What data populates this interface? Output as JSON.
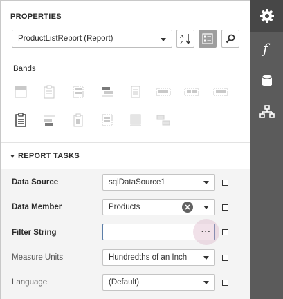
{
  "properties": {
    "title": "PROPERTIES",
    "selected_component": "ProductListReport (Report)"
  },
  "toolbar": {
    "sort_icon": "sort-alphabetical-icon",
    "categorized_icon": "categorized-view-icon",
    "search_icon": "search-icon"
  },
  "bands": {
    "label": "Bands"
  },
  "report_tasks": {
    "header": "REPORT TASKS",
    "rows": [
      {
        "label": "Data Source",
        "value": "sqlDataSource1",
        "placeholder": ""
      },
      {
        "label": "Data Member",
        "value": "Products",
        "placeholder": ""
      },
      {
        "label": "Filter String",
        "value": "",
        "placeholder": ""
      },
      {
        "label": "Measure Units",
        "value": "Hundredths of an Inch",
        "placeholder": ""
      },
      {
        "label": "Language",
        "value": "(Default)",
        "placeholder": ""
      }
    ],
    "ellipsis": "···"
  },
  "side_tabs": [
    "gear-icon",
    "function-icon",
    "database-icon",
    "hierarchy-icon"
  ],
  "colors": {
    "rail": "#5b5b5b",
    "rail_active": "#474747",
    "tasks_background": "#f4f4f4",
    "focus_border": "#5c7ea8",
    "ellipsis_highlight": "#e7c6d6"
  }
}
